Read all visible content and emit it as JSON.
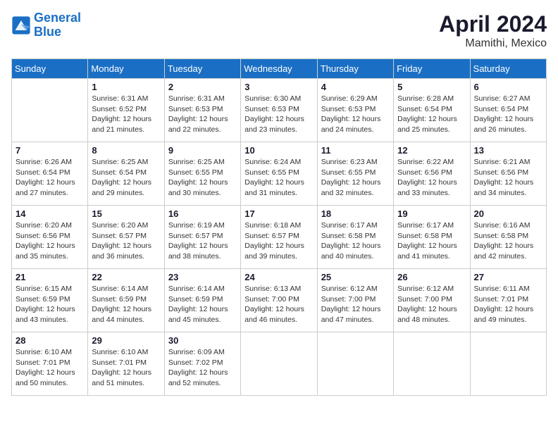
{
  "header": {
    "logo_line1": "General",
    "logo_line2": "Blue",
    "month_year": "April 2024",
    "location": "Mamithi, Mexico"
  },
  "weekdays": [
    "Sunday",
    "Monday",
    "Tuesday",
    "Wednesday",
    "Thursday",
    "Friday",
    "Saturday"
  ],
  "weeks": [
    [
      {
        "day": "",
        "info": ""
      },
      {
        "day": "1",
        "info": "Sunrise: 6:31 AM\nSunset: 6:52 PM\nDaylight: 12 hours\nand 21 minutes."
      },
      {
        "day": "2",
        "info": "Sunrise: 6:31 AM\nSunset: 6:53 PM\nDaylight: 12 hours\nand 22 minutes."
      },
      {
        "day": "3",
        "info": "Sunrise: 6:30 AM\nSunset: 6:53 PM\nDaylight: 12 hours\nand 23 minutes."
      },
      {
        "day": "4",
        "info": "Sunrise: 6:29 AM\nSunset: 6:53 PM\nDaylight: 12 hours\nand 24 minutes."
      },
      {
        "day": "5",
        "info": "Sunrise: 6:28 AM\nSunset: 6:54 PM\nDaylight: 12 hours\nand 25 minutes."
      },
      {
        "day": "6",
        "info": "Sunrise: 6:27 AM\nSunset: 6:54 PM\nDaylight: 12 hours\nand 26 minutes."
      }
    ],
    [
      {
        "day": "7",
        "info": "Sunrise: 6:26 AM\nSunset: 6:54 PM\nDaylight: 12 hours\nand 27 minutes."
      },
      {
        "day": "8",
        "info": "Sunrise: 6:25 AM\nSunset: 6:54 PM\nDaylight: 12 hours\nand 29 minutes."
      },
      {
        "day": "9",
        "info": "Sunrise: 6:25 AM\nSunset: 6:55 PM\nDaylight: 12 hours\nand 30 minutes."
      },
      {
        "day": "10",
        "info": "Sunrise: 6:24 AM\nSunset: 6:55 PM\nDaylight: 12 hours\nand 31 minutes."
      },
      {
        "day": "11",
        "info": "Sunrise: 6:23 AM\nSunset: 6:55 PM\nDaylight: 12 hours\nand 32 minutes."
      },
      {
        "day": "12",
        "info": "Sunrise: 6:22 AM\nSunset: 6:56 PM\nDaylight: 12 hours\nand 33 minutes."
      },
      {
        "day": "13",
        "info": "Sunrise: 6:21 AM\nSunset: 6:56 PM\nDaylight: 12 hours\nand 34 minutes."
      }
    ],
    [
      {
        "day": "14",
        "info": "Sunrise: 6:20 AM\nSunset: 6:56 PM\nDaylight: 12 hours\nand 35 minutes."
      },
      {
        "day": "15",
        "info": "Sunrise: 6:20 AM\nSunset: 6:57 PM\nDaylight: 12 hours\nand 36 minutes."
      },
      {
        "day": "16",
        "info": "Sunrise: 6:19 AM\nSunset: 6:57 PM\nDaylight: 12 hours\nand 38 minutes."
      },
      {
        "day": "17",
        "info": "Sunrise: 6:18 AM\nSunset: 6:57 PM\nDaylight: 12 hours\nand 39 minutes."
      },
      {
        "day": "18",
        "info": "Sunrise: 6:17 AM\nSunset: 6:58 PM\nDaylight: 12 hours\nand 40 minutes."
      },
      {
        "day": "19",
        "info": "Sunrise: 6:17 AM\nSunset: 6:58 PM\nDaylight: 12 hours\nand 41 minutes."
      },
      {
        "day": "20",
        "info": "Sunrise: 6:16 AM\nSunset: 6:58 PM\nDaylight: 12 hours\nand 42 minutes."
      }
    ],
    [
      {
        "day": "21",
        "info": "Sunrise: 6:15 AM\nSunset: 6:59 PM\nDaylight: 12 hours\nand 43 minutes."
      },
      {
        "day": "22",
        "info": "Sunrise: 6:14 AM\nSunset: 6:59 PM\nDaylight: 12 hours\nand 44 minutes."
      },
      {
        "day": "23",
        "info": "Sunrise: 6:14 AM\nSunset: 6:59 PM\nDaylight: 12 hours\nand 45 minutes."
      },
      {
        "day": "24",
        "info": "Sunrise: 6:13 AM\nSunset: 7:00 PM\nDaylight: 12 hours\nand 46 minutes."
      },
      {
        "day": "25",
        "info": "Sunrise: 6:12 AM\nSunset: 7:00 PM\nDaylight: 12 hours\nand 47 minutes."
      },
      {
        "day": "26",
        "info": "Sunrise: 6:12 AM\nSunset: 7:00 PM\nDaylight: 12 hours\nand 48 minutes."
      },
      {
        "day": "27",
        "info": "Sunrise: 6:11 AM\nSunset: 7:01 PM\nDaylight: 12 hours\nand 49 minutes."
      }
    ],
    [
      {
        "day": "28",
        "info": "Sunrise: 6:10 AM\nSunset: 7:01 PM\nDaylight: 12 hours\nand 50 minutes."
      },
      {
        "day": "29",
        "info": "Sunrise: 6:10 AM\nSunset: 7:01 PM\nDaylight: 12 hours\nand 51 minutes."
      },
      {
        "day": "30",
        "info": "Sunrise: 6:09 AM\nSunset: 7:02 PM\nDaylight: 12 hours\nand 52 minutes."
      },
      {
        "day": "",
        "info": ""
      },
      {
        "day": "",
        "info": ""
      },
      {
        "day": "",
        "info": ""
      },
      {
        "day": "",
        "info": ""
      }
    ]
  ]
}
